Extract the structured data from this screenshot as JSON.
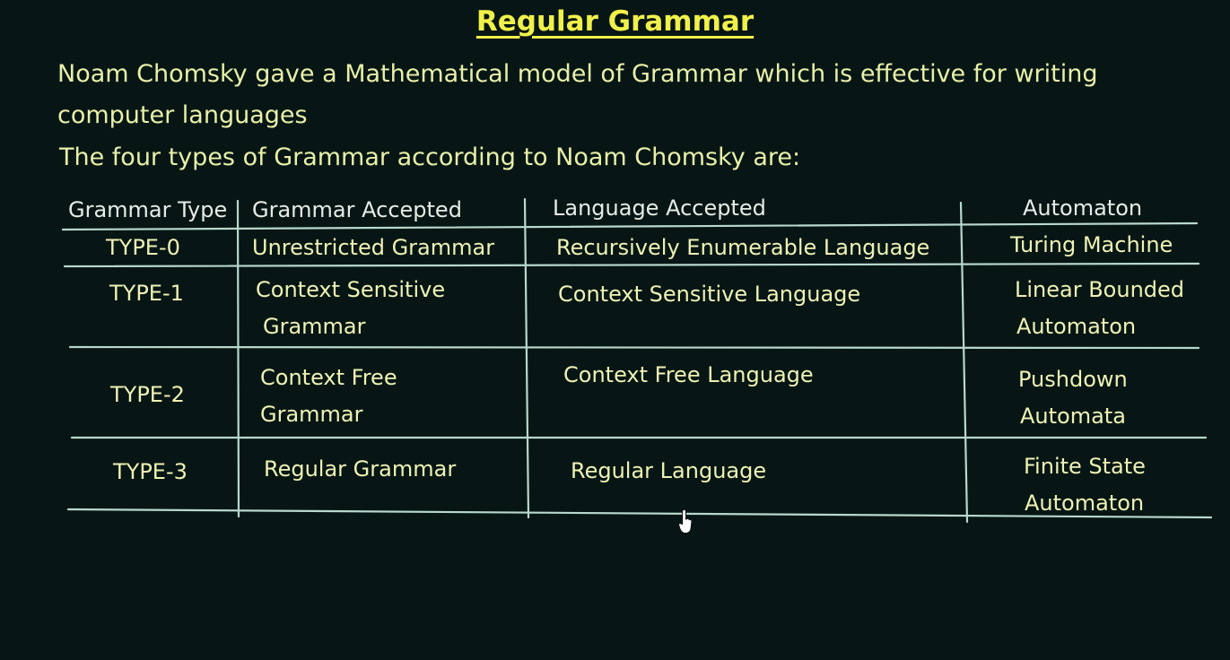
{
  "title": "Regular Grammar",
  "intro": "Noam Chomsky gave a Mathematical model of Grammar which is effective for writing computer languages",
  "types_line": "The four types of Grammar according to Noam Chomsky are:",
  "table": {
    "headers": [
      "Grammar Type",
      "Grammar Accepted",
      "Language Accepted",
      "Automaton"
    ],
    "rows": [
      {
        "type": "TYPE-0",
        "grammar": [
          "Unrestricted Grammar"
        ],
        "language": "Recursively Enumerable Language",
        "automaton": [
          "Turing Machine"
        ]
      },
      {
        "type": "TYPE-1",
        "grammar": [
          "Context Sensitive",
          "Grammar"
        ],
        "language": "Context Sensitive Language",
        "automaton": [
          "Linear Bounded",
          "Automaton"
        ]
      },
      {
        "type": "TYPE-2",
        "grammar": [
          "Context Free",
          "Grammar"
        ],
        "language": "Context Free Language",
        "automaton": [
          "Pushdown",
          "Automata"
        ]
      },
      {
        "type": "TYPE-3",
        "grammar": [
          "Regular Grammar"
        ],
        "language": "Regular Language",
        "automaton": [
          "Finite State",
          "Automaton"
        ]
      }
    ]
  },
  "colors": {
    "background": "#071615",
    "title": "#f0f04a",
    "text": "#e8f0a8",
    "lines": "#b8d8cc"
  },
  "icons": {
    "cursor": "hand-pointer-icon"
  }
}
